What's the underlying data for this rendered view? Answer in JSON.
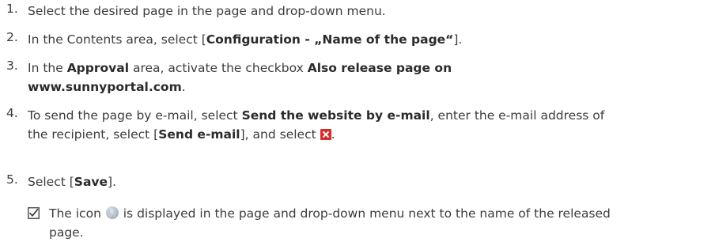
{
  "steps": [
    {
      "number": "1.",
      "text": "Select the desired page in the page and drop-down menu."
    },
    {
      "number": "2.",
      "pre": "In the Contents area, select [",
      "bold": "Configuration - „Name of the page“",
      "post": "]."
    },
    {
      "number": "3.",
      "pre": "In the ",
      "bold1": "Approval",
      "mid": " area, activate the checkbox ",
      "bold2_line1": "Also release page on",
      "bold2_line2": "www.sunnyportal.com",
      "post": "."
    },
    {
      "number": "4.",
      "pre": "To send the page by e-mail, select ",
      "bold1": "Send the website by e-mail",
      "mid": ", enter the e-mail address of",
      "line2_pre": "the recipient, select [",
      "bold2": "Send e-mail",
      "line2_mid": "], and select ",
      "line2_post": ".",
      "close_icon": "close-x-icon"
    },
    {
      "number": "5.",
      "pre": "Select [",
      "bold": "Save",
      "post": "]."
    }
  ],
  "result": {
    "check_icon": "checked-box-icon",
    "globe_icon": "globe-icon",
    "text_pre": "The icon ",
    "text_post": " is displayed in the page and drop-down menu next to the name of the released",
    "line2": "page."
  },
  "colors": {
    "text": "#3c3c3c",
    "close_icon": "#d92b2b",
    "globe": "#9aa7b5"
  }
}
